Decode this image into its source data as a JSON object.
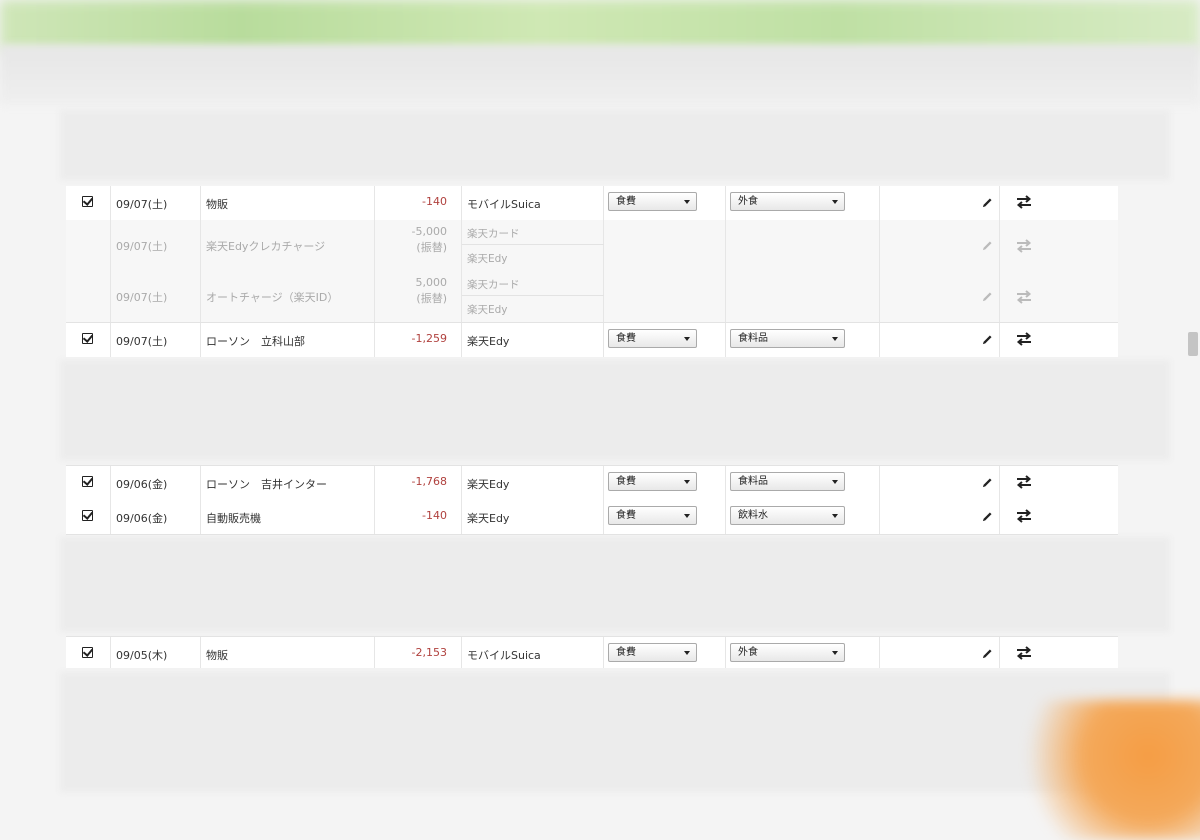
{
  "rows_group1": [
    {
      "checked": true,
      "date": "09/07(土)",
      "description": "物販",
      "amount": "-140",
      "account": "モバイルSuica",
      "category": "食費",
      "subcategory": "外食"
    },
    {
      "transfer": true,
      "date": "09/07(土)",
      "description": "楽天Edyクレカチャージ",
      "amount": "-5,000",
      "amount_note": "(振替)",
      "account_from": "楽天カード",
      "account_to": "楽天Edy"
    },
    {
      "transfer": true,
      "date": "09/07(土)",
      "description": "オートチャージ（楽天ID）",
      "amount": "5,000",
      "amount_note": "(振替)",
      "account_from": "楽天カード",
      "account_to": "楽天Edy"
    },
    {
      "checked": true,
      "date": "09/07(土)",
      "description": "ローソン　立科山部",
      "amount": "-1,259",
      "account": "楽天Edy",
      "category": "食費",
      "subcategory": "食料品"
    }
  ],
  "rows_group2": [
    {
      "checked": true,
      "date": "09/06(金)",
      "description": "ローソン　吉井インター",
      "amount": "-1,768",
      "account": "楽天Edy",
      "category": "食費",
      "subcategory": "食料品"
    },
    {
      "checked": true,
      "date": "09/06(金)",
      "description": "自動販売機",
      "amount": "-140",
      "account": "楽天Edy",
      "category": "食費",
      "subcategory": "飲料水"
    }
  ],
  "rows_group3": [
    {
      "checked": true,
      "date": "09/05(木)",
      "description": "物販",
      "amount": "-2,153",
      "account": "モバイルSuica",
      "category": "食費",
      "subcategory": "外食"
    }
  ],
  "icons": {
    "checkbox": "checked-checkbox-icon",
    "edit": "pencil-icon",
    "swap": "swap-arrows-icon",
    "dropdown": "caret-down-icon"
  },
  "colors": {
    "expense": "#b0413e",
    "transfer_text": "#aaaaaa",
    "row_background": "#ffffff",
    "transfer_background": "#f7f7f7"
  }
}
